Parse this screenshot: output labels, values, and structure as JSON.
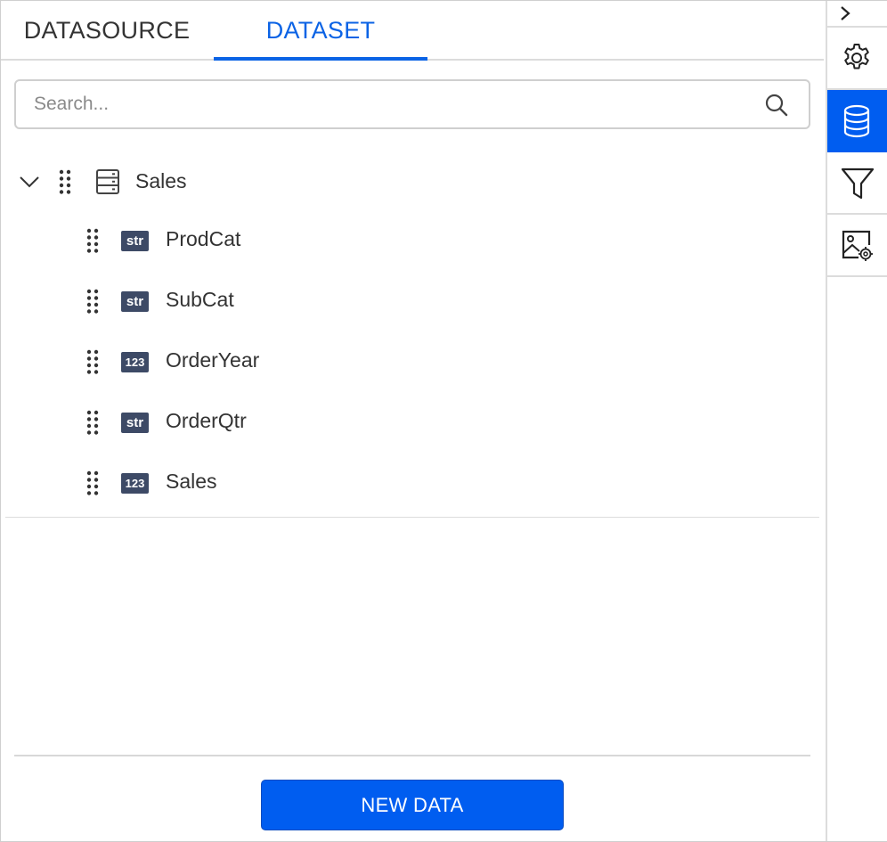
{
  "tabs": [
    {
      "label": "DATASOURCE",
      "active": false
    },
    {
      "label": "DATASET",
      "active": true
    }
  ],
  "search": {
    "placeholder": "Search...",
    "value": ""
  },
  "tree": {
    "root": {
      "label": "Sales",
      "icon": "table-icon",
      "expanded": true
    },
    "fields": [
      {
        "label": "ProdCat",
        "type": "str"
      },
      {
        "label": "SubCat",
        "type": "str"
      },
      {
        "label": "OrderYear",
        "type": "123"
      },
      {
        "label": "OrderQtr",
        "type": "str"
      },
      {
        "label": "Sales",
        "type": "123"
      }
    ]
  },
  "footer": {
    "new_data_label": "NEW DATA"
  },
  "toolbar": {
    "items": [
      {
        "icon": "chevron-right-icon"
      },
      {
        "icon": "gear-icon"
      },
      {
        "icon": "database-icon",
        "active": true
      },
      {
        "icon": "filter-icon"
      },
      {
        "icon": "image-settings-icon"
      }
    ]
  },
  "colors": {
    "accent": "#005df0",
    "tab_active": "#0b63e5",
    "badge": "#3d4a66"
  }
}
